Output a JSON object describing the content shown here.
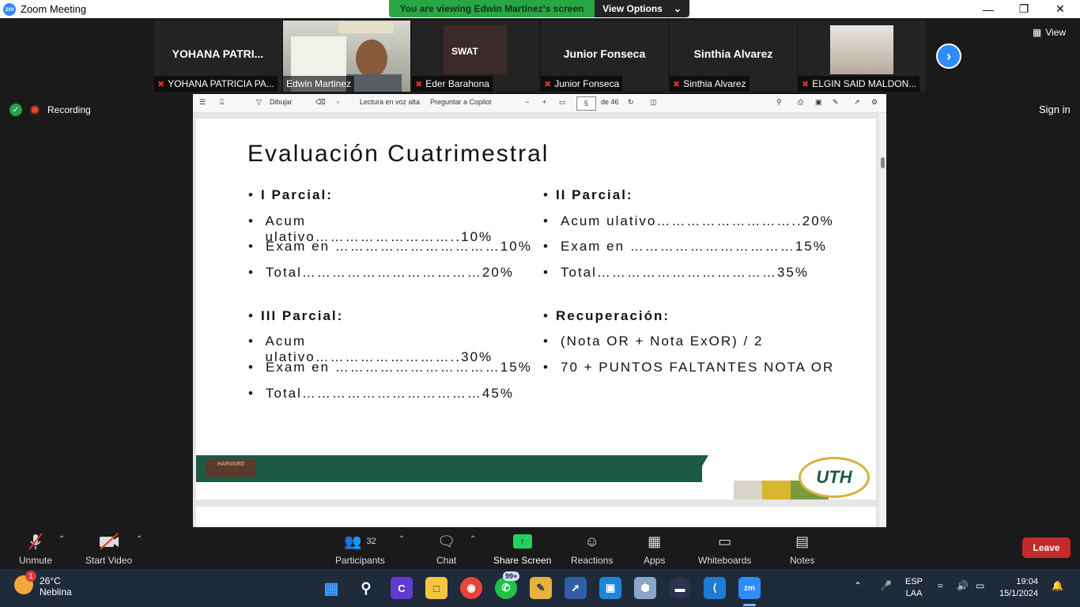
{
  "window": {
    "title": "Zoom Meeting",
    "logo": "zm"
  },
  "banner": {
    "viewing": "You are viewing Edwin Martínez's screen",
    "view_options": "View Options"
  },
  "participants": [
    {
      "big_name": "YOHANA PATRI...",
      "name": "YOHANA PATRICIA PA...",
      "muted": true
    },
    {
      "big_name": "",
      "name": "Edwin Martinez",
      "muted": false,
      "active": true
    },
    {
      "big_name": "",
      "name": "Eder Barahona",
      "muted": true,
      "thumb_text": "SWAT"
    },
    {
      "big_name": "Junior Fonseca",
      "name": "Junior Fonseca",
      "muted": true
    },
    {
      "big_name": "Sinthia Alvarez",
      "name": "Sinthia Alvarez",
      "muted": true
    },
    {
      "big_name": "",
      "name": "ELGIN SAID MALDON...",
      "muted": true
    }
  ],
  "view_button": "View",
  "recording": "Recording",
  "sign_in": "Sign in",
  "pdf_toolbar": {
    "draw": "Dibujar",
    "read_aloud": "Lectura en voz alta",
    "copilot": "Preguntar a Copilot",
    "page": "5",
    "of_pages": "de 46"
  },
  "slide": {
    "title": "Evaluación Cuatrimestral",
    "left_col": [
      {
        "text": "I Parcial:",
        "bold": true
      },
      {
        "text": "Acum ulativo………………………..10%"
      },
      {
        "text": "Exam en ……………………………10%"
      },
      {
        "text": "Total………………………………20%"
      },
      {
        "text": ""
      },
      {
        "text": "III Parcial:",
        "bold": true
      },
      {
        "text": "Acum ulativo………………………..30%"
      },
      {
        "text": "Exam en ……………………………15%"
      },
      {
        "text": "Total………………………………45%"
      }
    ],
    "right_col": [
      {
        "text": "II Parcial:",
        "bold": true
      },
      {
        "text": "Acum ulativo………………………..20%"
      },
      {
        "text": "Exam en ……………………………15%"
      },
      {
        "text": "Total………………………………35%"
      },
      {
        "text": ""
      },
      {
        "text": "Recuperación:",
        "bold": true
      },
      {
        "text": "(Nota OR + Nota ExOR) / 2"
      },
      {
        "text": "70 + PUNTOS FALTANTES NOTA OR"
      }
    ],
    "footer_left_logo": "HARVARD",
    "footer_right_logo": "UTH"
  },
  "toolbar": {
    "unmute": "Unmute",
    "start_video": "Start Video",
    "participants": "Participants",
    "participants_count": "32",
    "chat": "Chat",
    "share_screen": "Share Screen",
    "reactions": "Reactions",
    "apps": "Apps",
    "whiteboards": "Whiteboards",
    "notes": "Notes",
    "leave": "Leave"
  },
  "taskbar": {
    "temperature": "26°C",
    "weather": "Neblina",
    "weather_badge": "1",
    "whatsapp_badge": "99+",
    "language": "ESP",
    "layout": "LAA",
    "time": "19:04",
    "date": "15/1/2024"
  },
  "colors": {
    "zoom_blue": "#2d8cff",
    "leave_red": "#c4292b",
    "share_green": "#23d160",
    "slide_green": "#1d5a45"
  }
}
